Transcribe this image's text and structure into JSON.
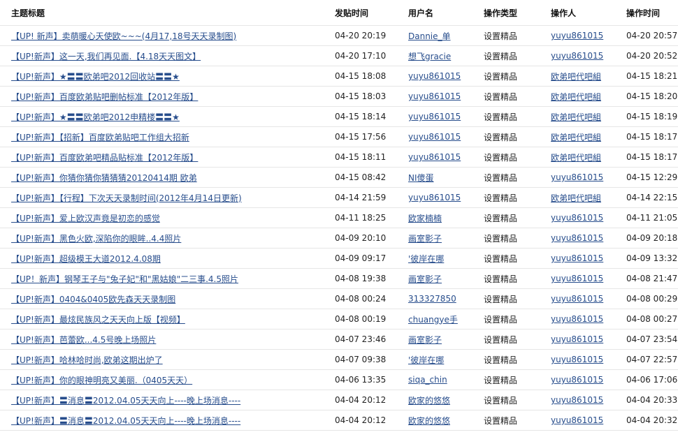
{
  "headers": {
    "title": "主题标题",
    "post_time": "发贴时间",
    "user": "用户名",
    "op_type": "操作类型",
    "operator": "操作人",
    "op_time": "操作时间"
  },
  "rows": [
    {
      "title": "【UP! 新声】卖萌暖心天使欧~~~(4月17,18号天天录制图)",
      "post_time": "04-20 20:19",
      "user": "Dannie_单",
      "op_type": "设置精品",
      "operator": "yuyu861015",
      "op_time": "04-20 20:57"
    },
    {
      "title": "【UP!新声】这一天,我们再见面.【4.18天天图文】",
      "post_time": "04-20 17:10",
      "user": "想飞gracie",
      "op_type": "设置精品",
      "operator": "yuyu861015",
      "op_time": "04-20 20:52"
    },
    {
      "title": "【UP!新声】★〓〓欧弟吧2012回收站〓〓★",
      "post_time": "04-15 18:08",
      "user": "yuyu861015",
      "op_type": "设置精品",
      "operator": "欧弟吧代吧組",
      "op_time": "04-15 18:21"
    },
    {
      "title": "【UP!新声】百度欧弟贴吧删帖标准【2012年版】",
      "post_time": "04-15 18:03",
      "user": "yuyu861015",
      "op_type": "设置精品",
      "operator": "欧弟吧代吧組",
      "op_time": "04-15 18:20"
    },
    {
      "title": "【UP!新声】★〓〓欧弟吧2012申精楼〓〓★",
      "post_time": "04-15 18:14",
      "user": "yuyu861015",
      "op_type": "设置精品",
      "operator": "欧弟吧代吧組",
      "op_time": "04-15 18:19"
    },
    {
      "title": "【UP!新声】【招新】百度欧弟贴吧工作组大招新",
      "post_time": "04-15 17:56",
      "user": "yuyu861015",
      "op_type": "设置精品",
      "operator": "欧弟吧代吧組",
      "op_time": "04-15 18:17"
    },
    {
      "title": "【UP!新声】百度欧弟吧精品贴标准【2012年版】",
      "post_time": "04-15 18:11",
      "user": "yuyu861015",
      "op_type": "设置精品",
      "operator": "欧弟吧代吧組",
      "op_time": "04-15 18:17"
    },
    {
      "title": "【UP!新声】你猜你猜你猜猜猜20120414期 欧弟",
      "post_time": "04-15 08:42",
      "user": "NI傻蛋",
      "op_type": "设置精品",
      "operator": "yuyu861015",
      "op_time": "04-15 12:29"
    },
    {
      "title": "【UP!新声】【行程】下次天天录制时间(2012年4月14日更新)",
      "post_time": "04-14 21:59",
      "user": "yuyu861015",
      "op_type": "设置精品",
      "operator": "欧弟吧代吧組",
      "op_time": "04-14 22:15"
    },
    {
      "title": "【UP!新声】爱上欧汉声竟是初恋的感觉",
      "post_time": "04-11 18:25",
      "user": "欧家楠楠",
      "op_type": "设置精品",
      "operator": "yuyu861015",
      "op_time": "04-11 21:05"
    },
    {
      "title": "【UP!新声】黑色火欧,深陷你的眼眸..4.4照片",
      "post_time": "04-09 20:10",
      "user": "画室影子",
      "op_type": "设置精品",
      "operator": "yuyu861015",
      "op_time": "04-09 20:18"
    },
    {
      "title": "【UP!新声】超级模王大道2012.4.08期",
      "post_time": "04-09 09:17",
      "user": "'彼岸在哪",
      "op_type": "设置精品",
      "operator": "yuyu861015",
      "op_time": "04-09 13:32"
    },
    {
      "title": "【UP！新声】钢琴王子与\"兔子妃\"和\"黑姑娘\"二三事.4.5照片",
      "post_time": "04-08 19:38",
      "user": "画室影子",
      "op_type": "设置精品",
      "operator": "yuyu861015",
      "op_time": "04-08 21:47"
    },
    {
      "title": "【UP!新声】0404&0405欧先森天天录制图",
      "post_time": "04-08 00:24",
      "user": "313327850",
      "op_type": "设置精品",
      "operator": "yuyu861015",
      "op_time": "04-08 00:29"
    },
    {
      "title": "【UP!新声】最炫民族风之天天向上版【视频】",
      "post_time": "04-08 00:19",
      "user": "chuangye手",
      "op_type": "设置精品",
      "operator": "yuyu861015",
      "op_time": "04-08 00:27"
    },
    {
      "title": "【UP!新声】芭蕾欧...4.5号晚上场照片",
      "post_time": "04-07 23:46",
      "user": "画室影子",
      "op_type": "设置精品",
      "operator": "yuyu861015",
      "op_time": "04-07 23:54"
    },
    {
      "title": "【UP!新声】哈林哈时尚,欧弟这期出炉了",
      "post_time": "04-07 09:38",
      "user": "'彼岸在哪",
      "op_type": "设置精品",
      "operator": "yuyu861015",
      "op_time": "04-07 22:57"
    },
    {
      "title": "【UP!新声】你的眼神明亮又美丽.（0405天天）",
      "post_time": "04-06 13:35",
      "user": "siqa_chin",
      "op_type": "设置精品",
      "operator": "yuyu861015",
      "op_time": "04-06 17:06"
    },
    {
      "title": "【UP!新声】〓消息〓2012.04.05天天向上----晚上场消息----",
      "post_time": "04-04 20:12",
      "user": "欧家的悠悠",
      "op_type": "设置精品",
      "operator": "yuyu861015",
      "op_time": "04-04 20:33"
    },
    {
      "title": "【UP!新声】〓消息〓2012.04.05天天向上----晚上场消息----",
      "post_time": "04-04 20:12",
      "user": "欧家的悠悠",
      "op_type": "设置精品",
      "operator": "yuyu861015",
      "op_time": "04-04 20:32"
    }
  ]
}
